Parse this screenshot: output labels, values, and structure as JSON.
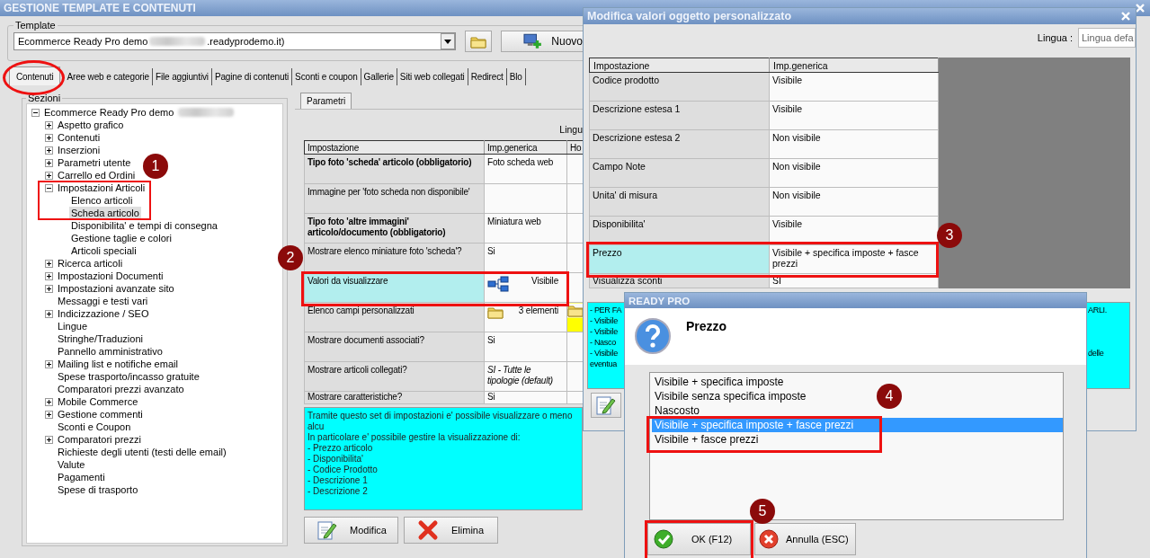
{
  "window": {
    "title": "GESTIONE TEMPLATE E CONTENUTI"
  },
  "template": {
    "label": "Template",
    "value_start": "Ecommerce Ready Pro demo",
    "redacted": true,
    "value_end": ".readyprodemo.it)",
    "new_button": "Nuovo"
  },
  "tabs": [
    {
      "label": "Contenuti",
      "selected": true
    },
    {
      "label": "Aree web e categorie",
      "selected": false
    },
    {
      "label": "File aggiuntivi",
      "selected": false
    },
    {
      "label": "Pagine di contenuti",
      "selected": false
    },
    {
      "label": "Sconti e coupon",
      "selected": false
    },
    {
      "label": "Gallerie",
      "selected": false
    },
    {
      "label": "Siti web collegati",
      "selected": false
    },
    {
      "label": "Redirect",
      "selected": false
    },
    {
      "label": "Blo",
      "selected": false
    }
  ],
  "sections": {
    "label": "Sezioni",
    "tree": [
      {
        "label": "Ecommerce Ready Pro demo",
        "redacted": true,
        "expanded": true,
        "selected": false,
        "children": [
          {
            "label": "Aspetto grafico",
            "expanded": false,
            "selected": false
          },
          {
            "label": "Contenuti",
            "expanded": false,
            "selected": false
          },
          {
            "label": "Inserzioni",
            "expanded": false,
            "selected": false
          },
          {
            "label": "Parametri utente",
            "expanded": false,
            "selected": false
          },
          {
            "label": "Carrello ed Ordini",
            "expanded": false,
            "selected": false
          },
          {
            "label": "Impostazioni Articoli",
            "expanded": true,
            "selected": false,
            "children": [
              {
                "label": "Elenco articoli",
                "selected": false
              },
              {
                "label": "Scheda articolo",
                "selected": true
              },
              {
                "label": "Disponibilita' e tempi di consegna",
                "selected": false
              },
              {
                "label": "Gestione taglie e colori",
                "selected": false
              },
              {
                "label": "Articoli speciali",
                "selected": false
              }
            ]
          },
          {
            "label": "Ricerca articoli",
            "expanded": false,
            "selected": false
          },
          {
            "label": "Impostazioni Documenti",
            "expanded": false,
            "selected": false
          },
          {
            "label": "Impostazioni avanzate sito",
            "expanded": false,
            "selected": false
          },
          {
            "label": "Messaggi e testi vari",
            "selected": false
          },
          {
            "label": "Indicizzazione / SEO",
            "expanded": false,
            "selected": false
          },
          {
            "label": "Lingue",
            "selected": false
          },
          {
            "label": "Stringhe/Traduzioni",
            "selected": false
          },
          {
            "label": "Pannello amministrativo",
            "selected": false
          },
          {
            "label": "Mailing list e notifiche email",
            "expanded": false,
            "selected": false
          },
          {
            "label": "Spese trasporto/incasso gratuite",
            "selected": false
          },
          {
            "label": "Comparatori prezzi avanzato",
            "selected": false
          },
          {
            "label": "Mobile Commerce",
            "expanded": false,
            "selected": false
          },
          {
            "label": "Gestione commenti",
            "expanded": false,
            "selected": false
          },
          {
            "label": "Sconti e Coupon",
            "selected": false
          },
          {
            "label": "Comparatori prezzi",
            "expanded": false,
            "selected": false
          },
          {
            "label": "Richieste degli utenti (testi delle email)",
            "selected": false
          },
          {
            "label": "Valute",
            "selected": false
          },
          {
            "label": "Pagamenti",
            "selected": false
          },
          {
            "label": "Spese di trasporto",
            "selected": false
          }
        ]
      }
    ]
  },
  "parameters": {
    "tab": {
      "label": "Parametri",
      "selected": true
    },
    "language_label": "Lingu",
    "columns": [
      "Impostazione",
      "Imp.generica",
      "Ho"
    ],
    "rows": [
      {
        "setting": "Tipo foto 'scheda' articolo (obbligatorio)",
        "value": "Foto scheda web",
        "bold": true,
        "italic": false,
        "selected": false
      },
      {
        "setting": "Immagine per 'foto scheda non disponibile'",
        "bold": false,
        "selected": false
      },
      {
        "setting": "Tipo foto 'altre immagini' articolo/documento (obbligatorio)",
        "value": "Miniatura web",
        "bold": true,
        "italic": false,
        "selected": false
      },
      {
        "setting": "Mostrare elenco miniature foto 'scheda'?",
        "value": "Si",
        "bold": false,
        "italic": false,
        "selected": false
      },
      {
        "setting": "Valori da visualizzare",
        "value": "Visibile",
        "kind": "structure",
        "bold": false,
        "italic": false,
        "selected": true
      },
      {
        "setting": "Elenco campi personalizzati",
        "value": "3 elementi",
        "kind": "list",
        "bold": false,
        "italic": false,
        "selected": false
      },
      {
        "setting": "Mostrare documenti associati?",
        "value": "Si",
        "bold": false,
        "italic": false,
        "selected": false
      },
      {
        "setting": "Mostrare articoli collegati?",
        "value": "SI - Tutte le tipologie (default)",
        "bold": false,
        "italic": true,
        "selected": false
      },
      {
        "setting": "Mostrare caratteristiche?",
        "value": "Si",
        "bold": false,
        "italic": false,
        "selected": false
      }
    ],
    "description": [
      "Tramite questo set di impostazioni e' possibile visualizzare o meno alcu",
      "In particolare e' possibile gestire la visualizzazione di:",
      "- Prezzo articolo",
      "- Disponibilita'",
      "- Codice Prodotto",
      "- Descrizione 1",
      "- Descrizione 2"
    ],
    "buttons": [
      {
        "label": "Modifica",
        "kind": "edit"
      },
      {
        "label": "Elimina",
        "kind": "delete"
      }
    ]
  },
  "custom_object_dialog": {
    "title": "Modifica valori oggetto personalizzato",
    "language_label": "Lingua :",
    "language_value": "Lingua defa",
    "columns": [
      "Impostazione",
      "Imp.generica"
    ],
    "rows": [
      {
        "setting": "Codice prodotto",
        "value": "Visibile",
        "selected": false
      },
      {
        "setting": "Descrizione estesa 1",
        "value": "Visibile",
        "selected": false
      },
      {
        "setting": "Descrizione estesa 2",
        "value": "Non visibile",
        "selected": false
      },
      {
        "setting": "Campo Note",
        "value": "Non visibile",
        "selected": false
      },
      {
        "setting": "Unita' di misura",
        "value": "Non visibile",
        "selected": false
      },
      {
        "setting": "Disponibilita'",
        "value": "Visibile",
        "selected": false
      },
      {
        "setting": "Prezzo",
        "value": "Visibile + specifica imposte + fasce prezzi",
        "selected": true
      },
      {
        "setting": "Visualizza sconti",
        "value": "SI",
        "selected": false
      }
    ],
    "notes": [
      {
        "left": "- PER FA",
        "right": "ARLI."
      },
      {
        "left": "- Visibile"
      },
      {
        "left": "- Visibile"
      },
      {
        "left": "- Nasco"
      },
      {
        "left": "- Visibile",
        "right": "delle"
      },
      {
        "left": "eventua"
      }
    ]
  },
  "prompt_dialog": {
    "title": "READY PRO",
    "heading": "Prezzo",
    "options": [
      {
        "label": "Visibile + specifica imposte",
        "selected": false
      },
      {
        "label": "Visibile senza specifica imposte",
        "selected": false
      },
      {
        "label": "Nascosto",
        "selected": false
      },
      {
        "label": "Visibile + specifica imposte + fasce prezzi",
        "selected": true
      },
      {
        "label": "Visibile + fasce prezzi",
        "selected": false
      }
    ],
    "buttons": [
      {
        "label": "OK (F12)",
        "kind": "ok"
      },
      {
        "label": "Annulla (ESC)",
        "kind": "cancel"
      }
    ]
  },
  "annotations": [
    {
      "number": "1"
    },
    {
      "number": "2"
    },
    {
      "number": "3"
    },
    {
      "number": "4"
    },
    {
      "number": "5"
    }
  ]
}
